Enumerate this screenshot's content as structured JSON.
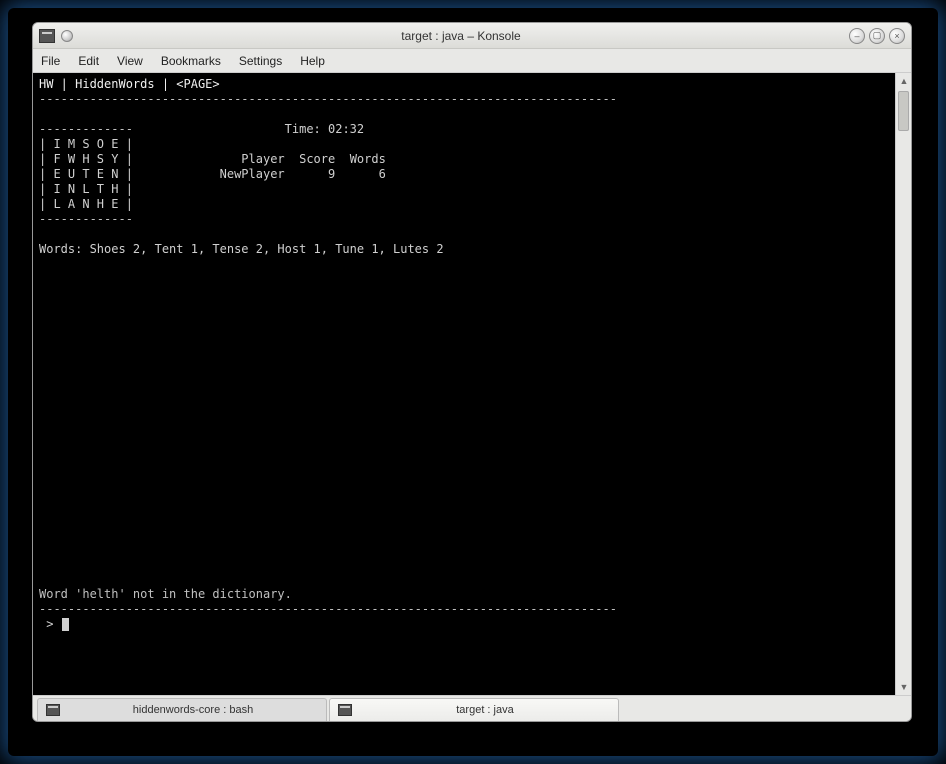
{
  "window": {
    "title": "target : java – Konsole"
  },
  "menu": {
    "file": "File",
    "edit": "Edit",
    "view": "View",
    "bookmarks": "Bookmarks",
    "settings": "Settings",
    "help": "Help"
  },
  "term": {
    "breadcrumb": "HW | HiddenWords | <PAGE>",
    "dash_full": "--------------------------------------------------------------------------------",
    "dash_short": "-------------",
    "time_label": "Time:",
    "time_value": "02:32",
    "grid": {
      "r1": "| I M S O E |",
      "r2": "| F W H S Y |",
      "r3": "| E U T E N |",
      "r4": "| I N L T H |",
      "r5": "| L A N H E |"
    },
    "header": {
      "player": "Player",
      "score": "Score",
      "words": "Words"
    },
    "playerRow": {
      "name": "NewPlayer",
      "score": "9",
      "words": "6"
    },
    "words_line": "Words: Shoes 2, Tent 1, Tense 2, Host 1, Tune 1, Lutes 2",
    "error": "Word 'helth' not in the dictionary.",
    "prompt": " > "
  },
  "tabs": {
    "t1": "hiddenwords-core : bash",
    "t2": "target : java"
  }
}
